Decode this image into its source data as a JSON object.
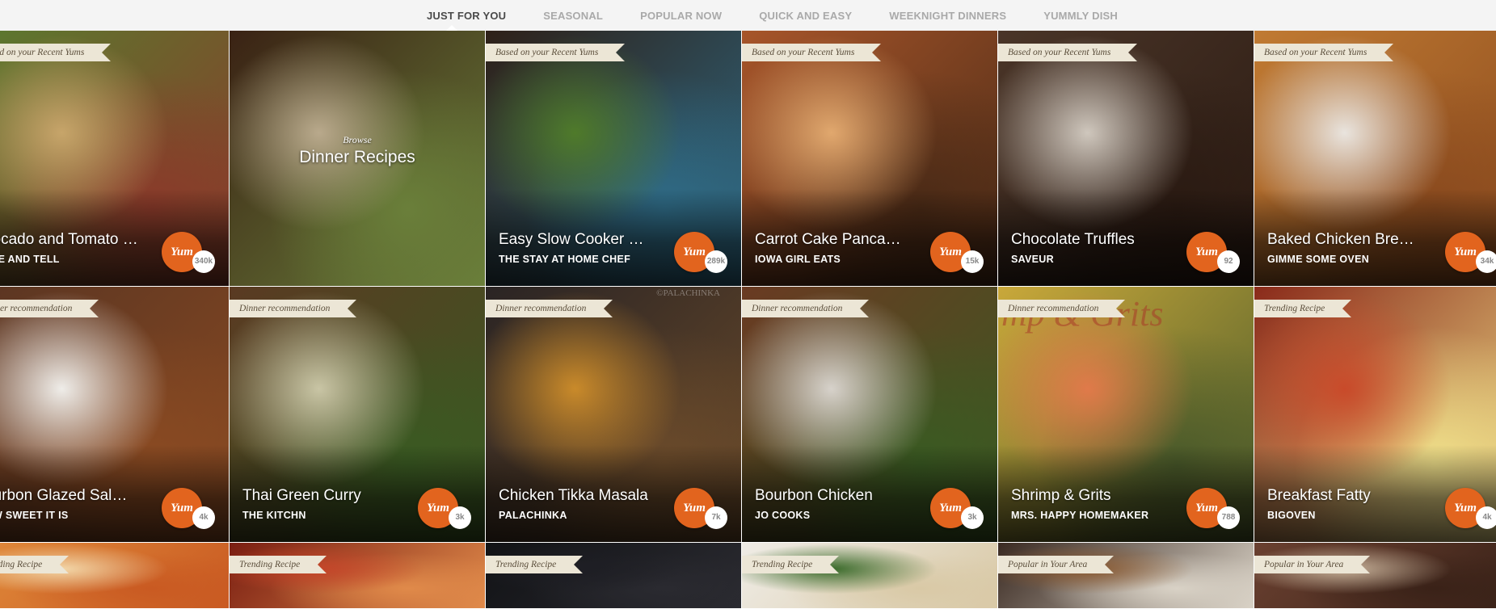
{
  "nav": {
    "tabs": [
      {
        "label": "JUST FOR YOU",
        "active": true
      },
      {
        "label": "SEASONAL",
        "active": false
      },
      {
        "label": "POPULAR NOW",
        "active": false
      },
      {
        "label": "QUICK AND EASY",
        "active": false
      },
      {
        "label": "WEEKNIGHT DINNERS",
        "active": false
      },
      {
        "label": "YUMMLY DISH",
        "active": false
      }
    ]
  },
  "cards": [
    {
      "ribbon": "Based on your Recent Yums",
      "title": "Avocado and Tomato Salad",
      "title_visible": "vocado and Tomato S...",
      "source": "STE AND TELL",
      "yum": "Yum",
      "count": "340k",
      "palette": [
        "#5a7a2e",
        "#c7a56a",
        "#8a3a2a"
      ]
    },
    {
      "browse_label": "Browse",
      "browse_title": "Dinner Recipes",
      "palette": [
        "#3a2214",
        "#b9a98c",
        "#6a7f3a"
      ]
    },
    {
      "ribbon": "Based on your Recent Yums",
      "title": "Easy Slow Cooker Chili-...",
      "source": "THE STAY AT HOME CHEF",
      "yum": "Yum",
      "count": "289k",
      "palette": [
        "#2e2018",
        "#4f7a2a",
        "#2f6b86"
      ]
    },
    {
      "ribbon": "Based on your Recent Yums",
      "title": "Carrot Cake Pancakes",
      "source": "IOWA GIRL EATS",
      "yum": "Yum",
      "count": "15k",
      "palette": [
        "#a7552a",
        "#e1a86e",
        "#4a2a16"
      ]
    },
    {
      "ribbon": "Based on your Recent Yums",
      "title": "Chocolate Truffles",
      "source": "SAVEUR",
      "yum": "Yum",
      "count": "92",
      "palette": [
        "#4a3528",
        "#cfc7bd",
        "#2a1a12"
      ]
    },
    {
      "ribbon": "Based on your Recent Yums",
      "title": "Baked Chicken Breasts",
      "source": "GIMME SOME OVEN",
      "yum": "Yum",
      "count": "34k",
      "palette": [
        "#c07a32",
        "#e9e4de",
        "#8a4a1e"
      ]
    },
    {
      "ribbon": "Dinner recommendation",
      "title": "Bourbon Glazed Salmon",
      "title_visible": "ourbon Glazed Salmon",
      "source": "OW SWEET IT IS",
      "yum": "Yum",
      "count": "4k",
      "palette": [
        "#5a3522",
        "#efede9",
        "#8a4a22"
      ]
    },
    {
      "ribbon": "Dinner recommendation",
      "title": "Thai Green Curry",
      "source": "THE KITCHN",
      "yum": "Yum",
      "count": "3k",
      "palette": [
        "#5a3a22",
        "#c9c5a5",
        "#3a5a22"
      ]
    },
    {
      "ribbon": "Dinner recommendation",
      "title": "Chicken Tikka Masala",
      "source": "PALACHINKA",
      "yum": "Yum",
      "count": "7k",
      "palette": [
        "#2a2424",
        "#c98a2a",
        "#6a4a2a"
      ],
      "watermark": "©PALACHINKA"
    },
    {
      "ribbon": "Dinner recommendation",
      "title": "Bourbon Chicken",
      "source": "JO COOKS",
      "yum": "Yum",
      "count": "3k",
      "palette": [
        "#6a3a22",
        "#d7d2cb",
        "#3a5a22"
      ]
    },
    {
      "ribbon": "Dinner recommendation",
      "title": "Shrimp & Grits",
      "source": "MRS. HAPPY HOMEMAKER",
      "yum": "Yum",
      "count": "788",
      "palette": [
        "#c9a83a",
        "#e07a4a",
        "#4a5a2a"
      ],
      "overlay": "mp & Grits"
    },
    {
      "ribbon": "Trending Recipe",
      "title": "Breakfast Fatty",
      "source": "BIGOVEN",
      "yum": "Yum",
      "count": "4k",
      "palette": [
        "#8a2a1a",
        "#c94a2a",
        "#f0e08a"
      ]
    },
    {
      "ribbon": "Trending Recipe",
      "palette": [
        "#e08a3a",
        "#f2d6a8",
        "#c95a22"
      ]
    },
    {
      "ribbon": "Trending Recipe",
      "palette": [
        "#7a1e12",
        "#c4462a",
        "#e08a4a"
      ]
    },
    {
      "ribbon": "Trending Recipe",
      "palette": [
        "#121316",
        "#1e1e24",
        "#2a2a30"
      ]
    },
    {
      "ribbon": "Trending Recipe",
      "palette": [
        "#efece6",
        "#3a6a2a",
        "#d9c9a6"
      ]
    },
    {
      "ribbon": "Popular in Your Area",
      "palette": [
        "#3a2a22",
        "#8a5a32",
        "#d9d2c6"
      ]
    },
    {
      "ribbon": "Popular in Your Area",
      "palette": [
        "#6a4030",
        "#c7b29a",
        "#3a2218"
      ]
    }
  ]
}
